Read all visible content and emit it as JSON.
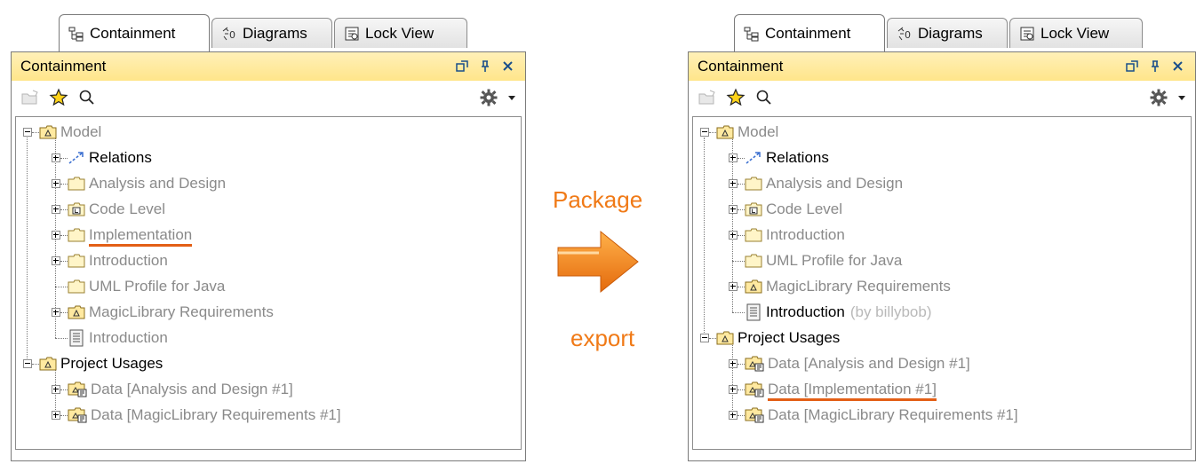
{
  "tabs": [
    {
      "label": "Containment",
      "icon": "containment-tab-icon",
      "active": true
    },
    {
      "label": "Diagrams",
      "icon": "diagrams-tab-icon"
    },
    {
      "label": "Lock View",
      "icon": "lock-view-tab-icon"
    }
  ],
  "panel_title": "Containment",
  "window_buttons": [
    "restore-icon",
    "pin-icon",
    "close-icon"
  ],
  "toolbar_icons": [
    "open-folder-icon",
    "favorite-star-icon",
    "search-icon",
    "gear-icon",
    "dropdown-arrow-icon"
  ],
  "arrow": {
    "top_text": "Package",
    "bottom_text": "export",
    "color": "#f07a17"
  },
  "left_tree": [
    {
      "label": "Model",
      "icon": "model-package",
      "style": "gray",
      "expand": "minus",
      "level": 0
    },
    {
      "label": "Relations",
      "icon": "relations",
      "style": "dark",
      "expand": "plus",
      "level": 1
    },
    {
      "label": "Analysis and Design",
      "icon": "folder",
      "style": "gray",
      "expand": "plus",
      "level": 1
    },
    {
      "label": "Code Level",
      "icon": "folder-l",
      "style": "gray",
      "expand": "plus",
      "level": 1
    },
    {
      "label": "Implementation",
      "icon": "folder",
      "style": "gray",
      "expand": "plus",
      "level": 1,
      "underline": true
    },
    {
      "label": "Introduction",
      "icon": "folder",
      "style": "gray",
      "expand": "plus",
      "level": 1
    },
    {
      "label": "UML Profile for Java",
      "icon": "folder",
      "style": "gray",
      "expand": "none",
      "level": 1
    },
    {
      "label": "MagicLibrary Requirements",
      "icon": "model-package",
      "style": "gray",
      "expand": "plus",
      "level": 1
    },
    {
      "label": "Introduction",
      "icon": "document",
      "style": "gray",
      "expand": "none",
      "level": 1,
      "last": true
    },
    {
      "label": "Project Usages",
      "icon": "model-package",
      "style": "dark",
      "expand": "minus",
      "level": 0
    },
    {
      "label": "Data [Analysis and Design #1]",
      "icon": "usage-package",
      "style": "gray",
      "expand": "plus",
      "level": 1
    },
    {
      "label": "Data [MagicLibrary Requirements #1]",
      "icon": "usage-package",
      "style": "gray",
      "expand": "plus",
      "level": 1,
      "last": true
    }
  ],
  "right_tree": [
    {
      "label": "Model",
      "icon": "model-package",
      "style": "gray",
      "expand": "minus",
      "level": 0
    },
    {
      "label": "Relations",
      "icon": "relations",
      "style": "dark",
      "expand": "plus",
      "level": 1
    },
    {
      "label": "Analysis and Design",
      "icon": "folder",
      "style": "gray",
      "expand": "plus",
      "level": 1
    },
    {
      "label": "Code Level",
      "icon": "folder-l",
      "style": "gray",
      "expand": "plus",
      "level": 1
    },
    {
      "label": "Introduction",
      "icon": "folder",
      "style": "gray",
      "expand": "plus",
      "level": 1
    },
    {
      "label": "UML Profile for Java",
      "icon": "folder",
      "style": "gray",
      "expand": "none",
      "level": 1
    },
    {
      "label": "MagicLibrary Requirements",
      "icon": "model-package",
      "style": "gray",
      "expand": "plus",
      "level": 1
    },
    {
      "label": "Introduction",
      "suffix": "(by billybob)",
      "icon": "document",
      "style": "dark",
      "expand": "none",
      "level": 1,
      "last": true
    },
    {
      "label": "Project Usages",
      "icon": "model-package",
      "style": "dark",
      "expand": "minus",
      "level": 0
    },
    {
      "label": "Data [Analysis and Design #1]",
      "icon": "usage-package",
      "style": "gray",
      "expand": "plus",
      "level": 1
    },
    {
      "label": "Data [Implementation #1]",
      "icon": "usage-package",
      "style": "gray",
      "expand": "plus",
      "level": 1,
      "underline": true
    },
    {
      "label": "Data [MagicLibrary Requirements #1]",
      "icon": "usage-package",
      "style": "gray",
      "expand": "plus",
      "level": 1,
      "last": true
    }
  ]
}
